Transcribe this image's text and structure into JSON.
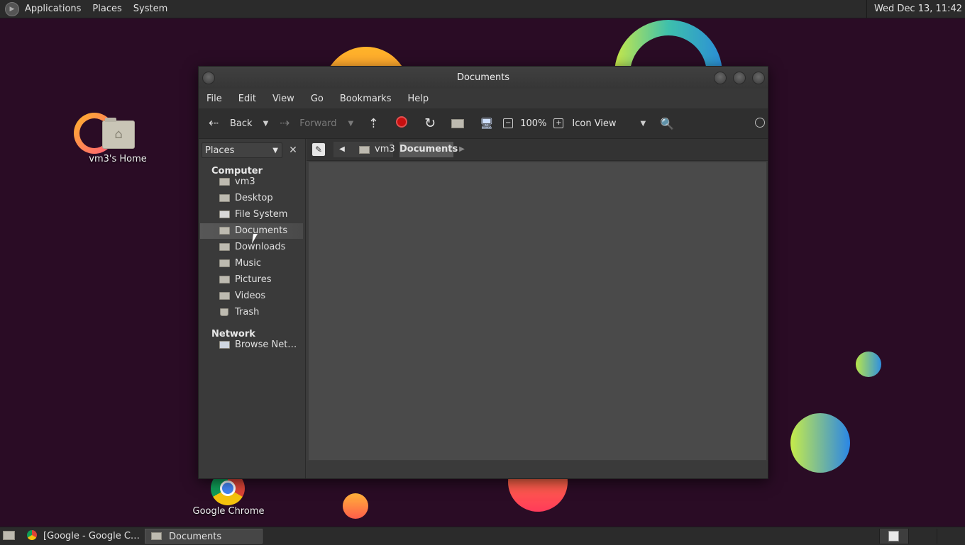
{
  "top_panel": {
    "menus": [
      "Applications",
      "Places",
      "System"
    ],
    "clock": "Wed Dec 13, 11:42"
  },
  "desktop_icons": {
    "home_label": "vm3's Home",
    "chrome_label": "Google Chrome"
  },
  "window": {
    "title": "Documents",
    "menubar": [
      "File",
      "Edit",
      "View",
      "Go",
      "Bookmarks",
      "Help"
    ],
    "toolbar": {
      "back": "Back",
      "forward": "Forward",
      "zoom": "100%",
      "view_mode": "Icon View"
    },
    "sidebar": {
      "selector": "Places",
      "sections": {
        "computer": "Computer",
        "network": "Network"
      },
      "items": [
        {
          "label": "vm3",
          "icon": "home-folder-icon"
        },
        {
          "label": "Desktop",
          "icon": "desktop-folder-icon"
        },
        {
          "label": "File System",
          "icon": "drive-icon"
        },
        {
          "label": "Documents",
          "icon": "folder-icon"
        },
        {
          "label": "Downloads",
          "icon": "folder-icon"
        },
        {
          "label": "Music",
          "icon": "folder-icon"
        },
        {
          "label": "Pictures",
          "icon": "folder-icon"
        },
        {
          "label": "Videos",
          "icon": "folder-icon"
        },
        {
          "label": "Trash",
          "icon": "trash-icon"
        }
      ],
      "network_items": [
        {
          "label": "Browse Net…",
          "icon": "network-icon"
        }
      ],
      "selected": "Documents"
    },
    "breadcrumbs": [
      "vm3",
      "Documents"
    ]
  },
  "taskbar": {
    "tasks": [
      "[Google - Google C…",
      "Documents"
    ]
  },
  "colors": {
    "panel": "#2b2b2b",
    "window_bg": "#3c3c3c",
    "content_bg": "#4a4a4a",
    "desktop_bg": "#2a0c25",
    "stop_red": "#c81010"
  }
}
